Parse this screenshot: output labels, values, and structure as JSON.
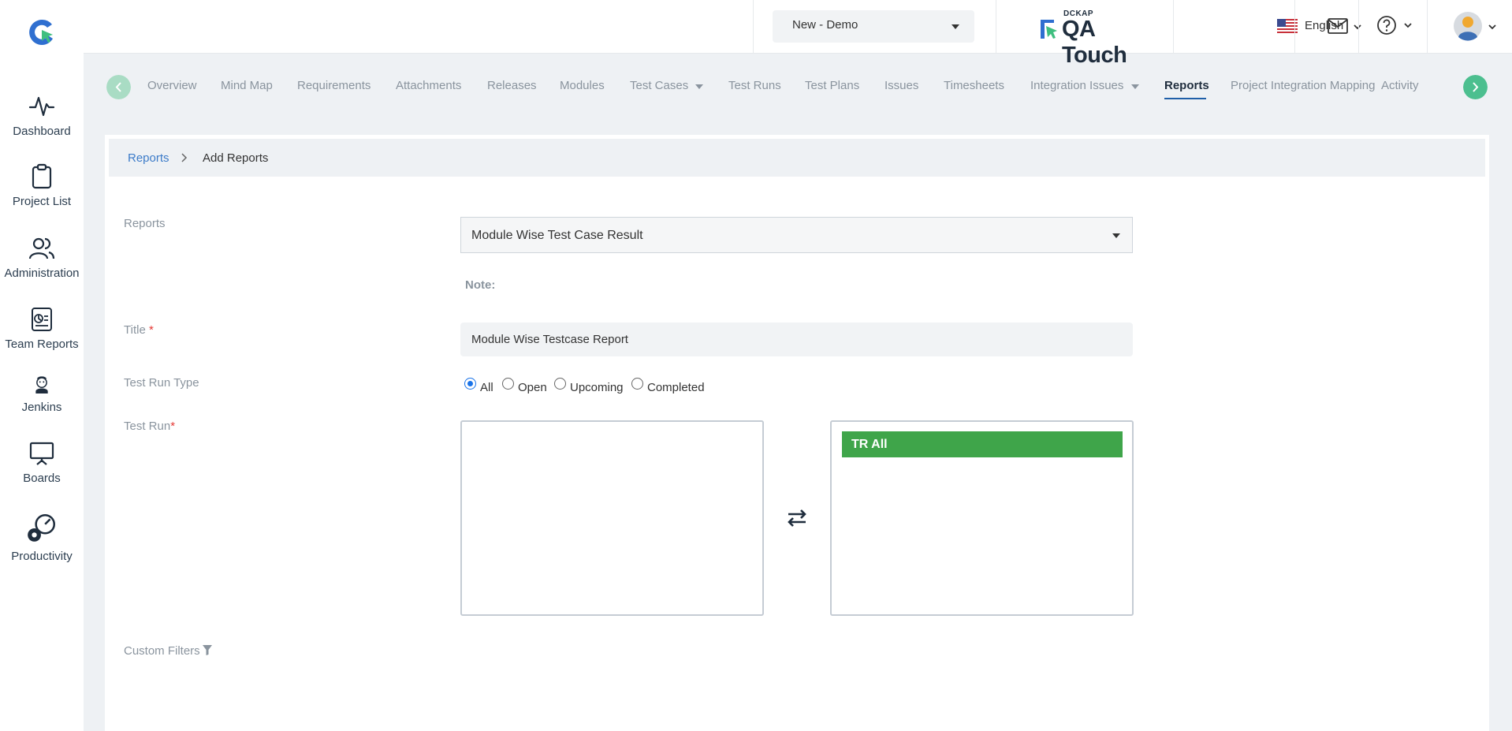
{
  "sidebar": {
    "items": [
      {
        "label": "Dashboard",
        "icon": "pulse-icon"
      },
      {
        "label": "Project List",
        "icon": "clipboard-icon"
      },
      {
        "label": "Administration",
        "icon": "users-icon"
      },
      {
        "label": "Team Reports",
        "icon": "report-icon"
      },
      {
        "label": "Jenkins",
        "icon": "jenkins-icon"
      },
      {
        "label": "Boards",
        "icon": "board-icon"
      },
      {
        "label": "Productivity",
        "icon": "gears-icon"
      }
    ]
  },
  "header": {
    "project_selected": "New - Demo",
    "brand_small": "DCKAP",
    "brand_name": "QA Touch",
    "language": "English"
  },
  "tabs": [
    {
      "label": "Overview"
    },
    {
      "label": "Mind Map"
    },
    {
      "label": "Requirements"
    },
    {
      "label": "Attachments"
    },
    {
      "label": "Releases"
    },
    {
      "label": "Modules"
    },
    {
      "label": "Test Cases"
    },
    {
      "label": "Test Runs"
    },
    {
      "label": "Test Plans"
    },
    {
      "label": "Issues"
    },
    {
      "label": "Timesheets"
    },
    {
      "label": "Integration Issues"
    },
    {
      "label": "Reports"
    },
    {
      "label": "Project Integration Mapping"
    },
    {
      "label": "Activity"
    }
  ],
  "active_tab": "Reports",
  "breadcrumb": {
    "parent": "Reports",
    "current": "Add Reports"
  },
  "form": {
    "reports_label": "Reports",
    "reports_value": "Module Wise Test Case Result",
    "note_label": "Note:",
    "title_label": "Title",
    "title_required": "*",
    "title_value": "Module Wise Testcase Report",
    "run_type_label": "Test Run Type",
    "run_type_options": [
      "All",
      "Open",
      "Upcoming",
      "Completed"
    ],
    "run_type_selected": "All",
    "test_run_label": "Test Run",
    "test_run_required": "*",
    "available_runs": [],
    "selected_runs": [
      "TR All"
    ],
    "custom_filters_label": "Custom Filters"
  },
  "colors": {
    "accent_blue": "#1f5fa8",
    "link_blue": "#3d7cc9",
    "nav_green": "#4cbf8f",
    "selected_green": "#3fa54a",
    "required_red": "#e53935"
  }
}
